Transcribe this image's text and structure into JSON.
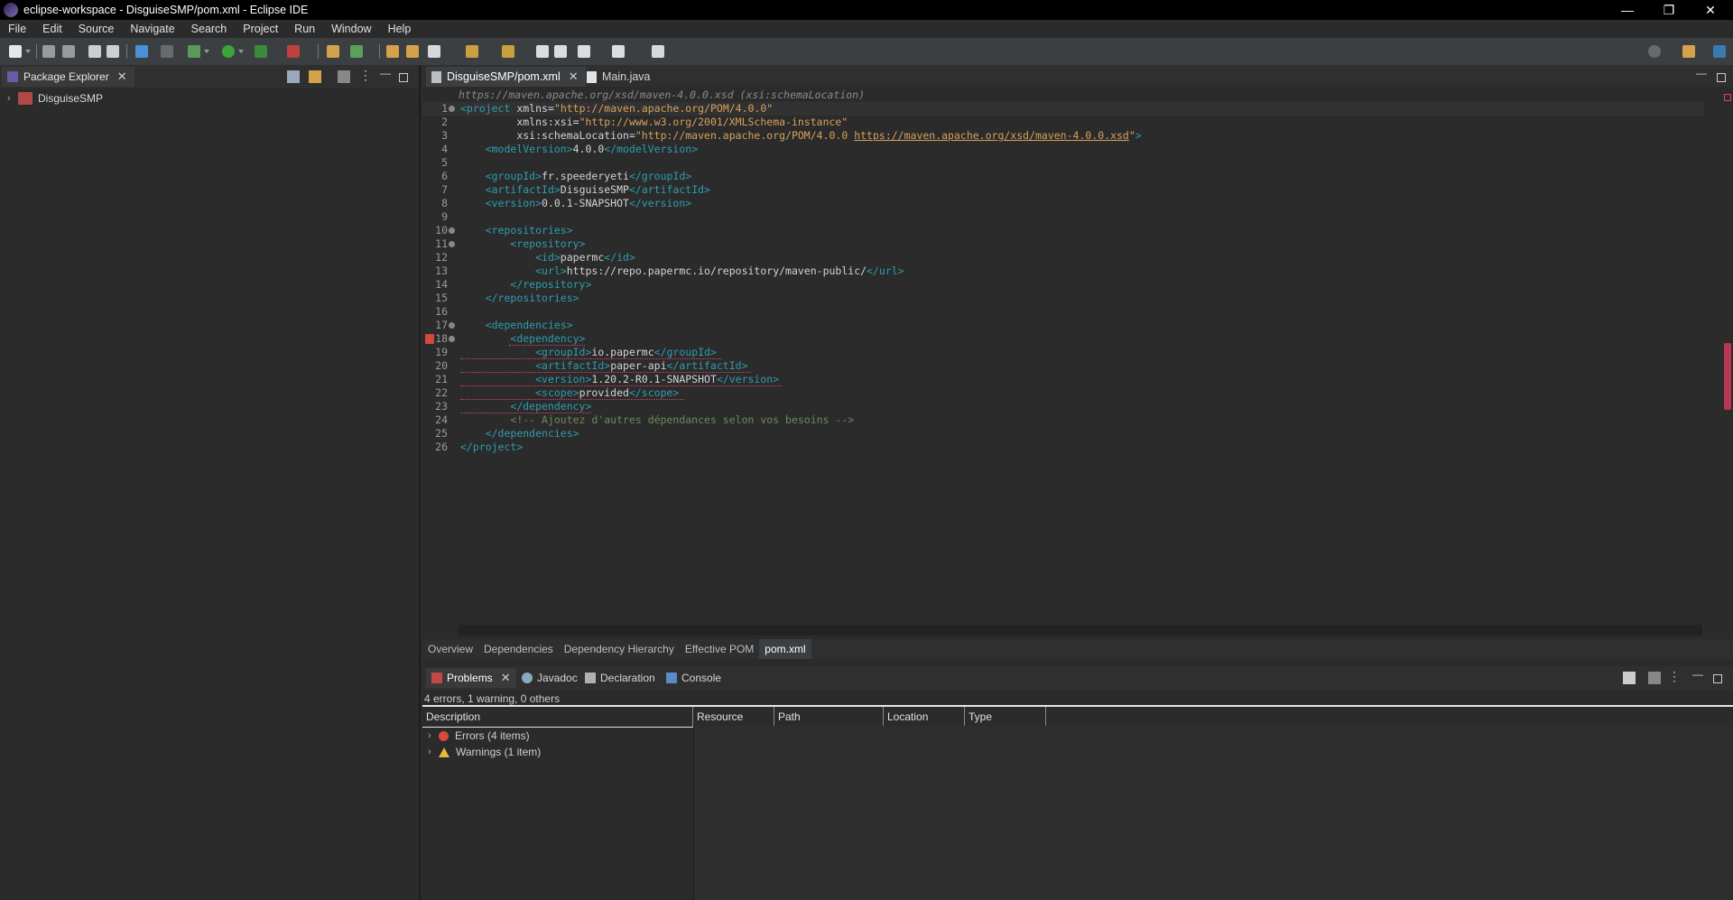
{
  "window": {
    "title": "eclipse-workspace - DisguiseSMP/pom.xml - Eclipse IDE"
  },
  "menu": [
    "File",
    "Edit",
    "Source",
    "Navigate",
    "Search",
    "Project",
    "Run",
    "Window",
    "Help"
  ],
  "package_explorer": {
    "tab_label": "Package Explorer",
    "project": "DisguiseSMP"
  },
  "editor": {
    "tabs": [
      {
        "label": "DisguiseSMP/pom.xml",
        "active": true
      },
      {
        "label": "Main.java",
        "active": false
      }
    ],
    "breadcrumb": "https://maven.apache.org/xsd/maven-4.0.0.xsd (xsi:schemaLocation)",
    "line_numbers": [
      "1",
      "2",
      "3",
      "4",
      "5",
      "6",
      "7",
      "8",
      "9",
      "10",
      "11",
      "12",
      "13",
      "14",
      "15",
      "16",
      "17",
      "18",
      "19",
      "20",
      "21",
      "22",
      "23",
      "24",
      "25",
      "26"
    ],
    "page_tabs": [
      "Overview",
      "Dependencies",
      "Dependency Hierarchy",
      "Effective POM",
      "pom.xml"
    ],
    "active_page_tab": "pom.xml"
  },
  "problems": {
    "tabs": [
      "Problems",
      "Javadoc",
      "Declaration",
      "Console"
    ],
    "summary": "4 errors, 1 warning, 0 others",
    "columns": [
      "Description",
      "Resource",
      "Path",
      "Location",
      "Type"
    ],
    "rows": [
      {
        "label": "Errors (4 items)",
        "kind": "error"
      },
      {
        "label": "Warnings (1 item)",
        "kind": "warning"
      }
    ]
  },
  "colors": {
    "background": "#2b2b2b",
    "tag": "#2f9cb0",
    "attr_value": "#d7a15b",
    "comment": "#6a8a5a",
    "error": "#e04060"
  }
}
